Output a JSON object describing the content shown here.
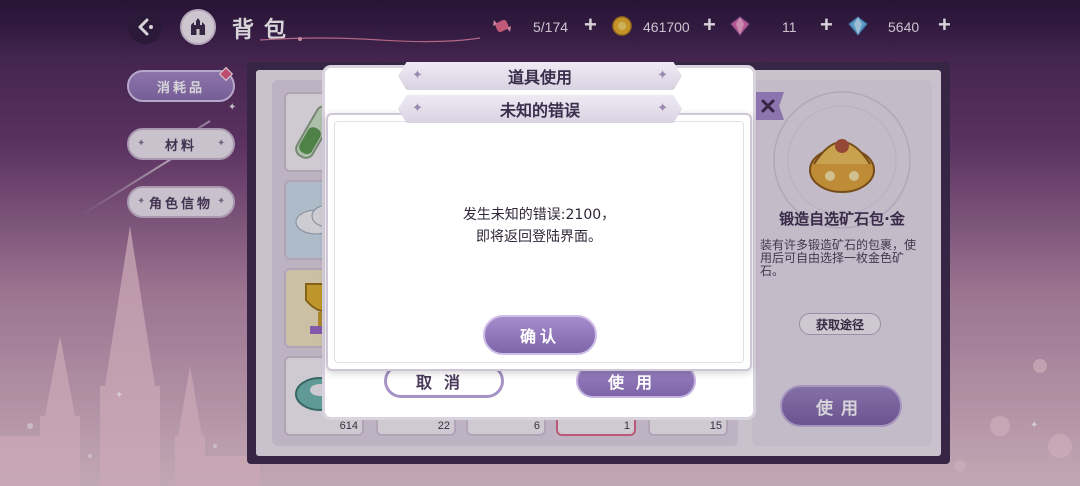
{
  "header": {
    "title": "背包",
    "resources": [
      {
        "icon": "candy-icon",
        "value": "5/174"
      },
      {
        "icon": "gold-coin-icon",
        "value": "461700"
      },
      {
        "icon": "pink-diamond-icon",
        "value": "11"
      },
      {
        "icon": "blue-diamond-icon",
        "value": "5640"
      }
    ],
    "plus_label": "+"
  },
  "sidebar": {
    "tabs": [
      {
        "label": "消耗品",
        "active": true
      },
      {
        "label": "材料",
        "active": false
      },
      {
        "label": "角色信物",
        "active": false
      }
    ]
  },
  "inventory": {
    "items": [
      {
        "icon": "potion-tube-icon",
        "count": ""
      },
      {
        "icon": "cloud-material-icon",
        "count": ""
      },
      {
        "icon": "gold-trophy-icon",
        "count": ""
      },
      {
        "icon": "tape-roll-icon",
        "count": "614"
      },
      {
        "icon": "item-icon",
        "count": "22"
      },
      {
        "icon": "item-icon",
        "count": "6"
      },
      {
        "icon": "item-icon",
        "count": "1"
      },
      {
        "icon": "item-icon",
        "count": "15"
      }
    ]
  },
  "detail": {
    "name": "锻造自选矿石包·金",
    "description": "装有许多锻造矿石的包裹，使用后可自由选择一枚金色矿石。",
    "source_button": "获取途径",
    "use_button": "使用",
    "close_icon": "close-icon"
  },
  "use_dialog": {
    "title": "道具使用",
    "cancel_button": "取消",
    "use_button": "使用"
  },
  "error_dialog": {
    "title": "未知的错误",
    "message_line1": "发生未知的错误:2100，",
    "message_line2": "即将返回登陆界面。",
    "confirm_button": "确认"
  },
  "colors": {
    "accent_purple": "#8a6fb0",
    "panel_dark": "#3c2a4c",
    "badge_pink": "#e25b82"
  }
}
